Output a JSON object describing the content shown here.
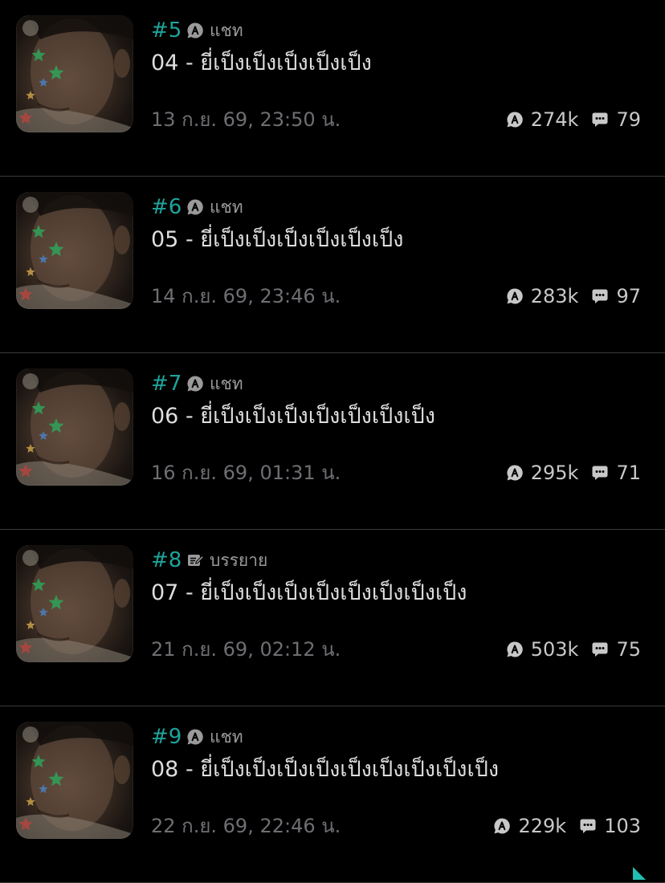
{
  "episodes": [
    {
      "number": "#5",
      "type_icon": "chat-bubble-a-icon",
      "type_label": "แชท",
      "title": "04 - ยี่เป็งเป็งเป็งเป็งเป็ง",
      "date": "13 ก.ย. 69, 23:50 น.",
      "reads": "274k",
      "comments": "79"
    },
    {
      "number": "#6",
      "type_icon": "chat-bubble-a-icon",
      "type_label": "แชท",
      "title": "05 - ยี่เป็งเป็งเป็งเป็งเป็งเป็ง",
      "date": "14 ก.ย. 69, 23:46 น.",
      "reads": "283k",
      "comments": "97"
    },
    {
      "number": "#7",
      "type_icon": "chat-bubble-a-icon",
      "type_label": "แชท",
      "title": "06 - ยี่เป็งเป็งเป็งเป็งเป็งเป็งเป็ง",
      "date": "16 ก.ย. 69, 01:31 น.",
      "reads": "295k",
      "comments": "71"
    },
    {
      "number": "#8",
      "type_icon": "edit-note-icon",
      "type_label": "บรรยาย",
      "title": "07 - ยี่เป็งเป็งเป็งเป็งเป็งเป็งเป็งเป็ง",
      "date": "21 ก.ย. 69, 02:12 น.",
      "reads": "503k",
      "comments": "75"
    },
    {
      "number": "#9",
      "type_icon": "chat-bubble-a-icon",
      "type_label": "แชท",
      "title": "08 - ยี่เป็งเป็งเป็งเป็งเป็งเป็งเป็งเป็งเป็ง",
      "date": "22 ก.ย. 69, 22:46 น.",
      "reads": "229k",
      "comments": "103"
    }
  ],
  "colors": {
    "background": "#000000",
    "episode_number": "#1fa39a",
    "title": "#dedede",
    "date": "#6e6e73",
    "divider": "#3a3a3c",
    "accent_corner": "#1fbfb3"
  }
}
